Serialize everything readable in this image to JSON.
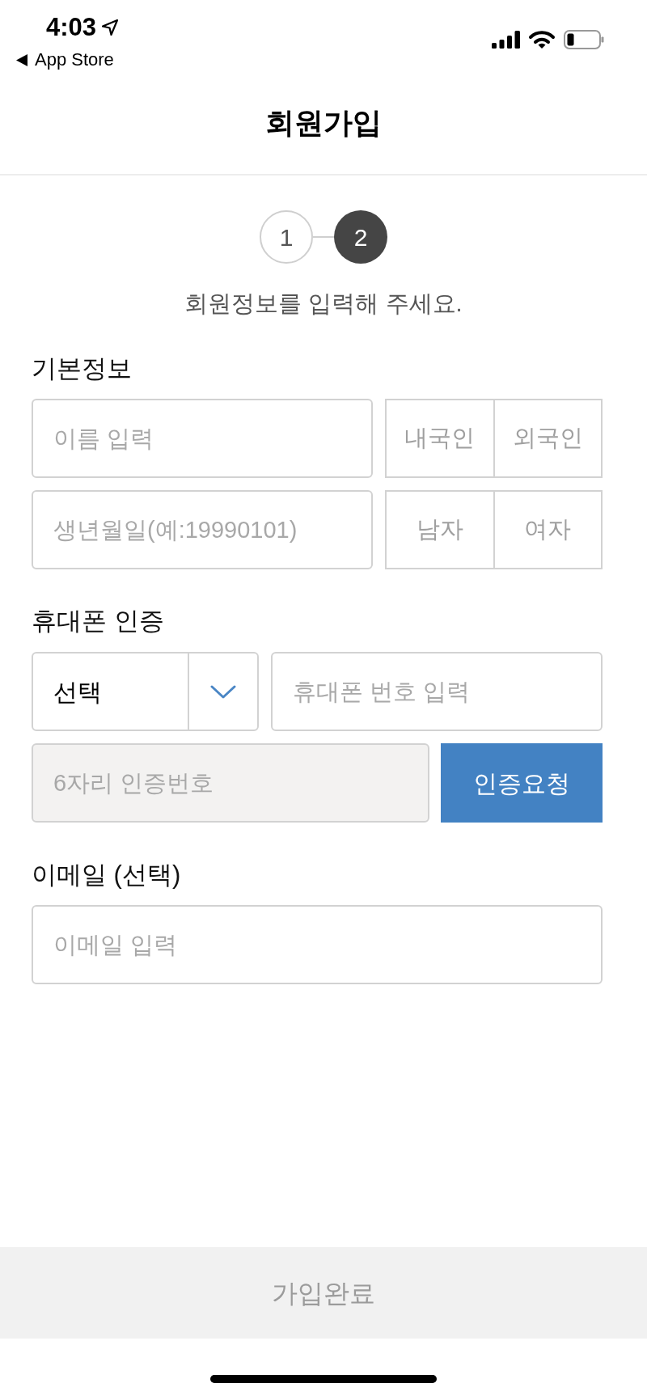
{
  "status_bar": {
    "time": "4:03",
    "back_label": "App Store"
  },
  "header": {
    "title": "회원가입"
  },
  "stepper": {
    "steps": [
      {
        "label": "1",
        "current": false
      },
      {
        "label": "2",
        "current": true
      }
    ],
    "caption": "회원정보를 입력해 주세요."
  },
  "basic_info": {
    "heading": "기본정보",
    "name_field": {
      "placeholder": "이름 입력"
    },
    "nationality": [
      {
        "label": "내국인",
        "selected": false
      },
      {
        "label": "외국인",
        "selected": false
      }
    ],
    "birth_field": {
      "placeholder": "생년월일(예:19990101)"
    },
    "gender": [
      {
        "label": "남자",
        "selected": false
      },
      {
        "label": "여자",
        "selected": false
      }
    ]
  },
  "phone_verification": {
    "heading": "휴대폰 인증",
    "carrier_select": {
      "value": "선택"
    },
    "phone_field": {
      "placeholder": "휴대폰 번호 입력"
    },
    "code_field": {
      "placeholder": "6자리 인증번호",
      "disabled": true
    },
    "request_button": {
      "label": "인증요청"
    }
  },
  "email": {
    "heading": "이메일 (선택)",
    "email_field": {
      "placeholder": "이메일 입력"
    }
  },
  "submit_button": {
    "label": "가입완료",
    "disabled": true
  }
}
